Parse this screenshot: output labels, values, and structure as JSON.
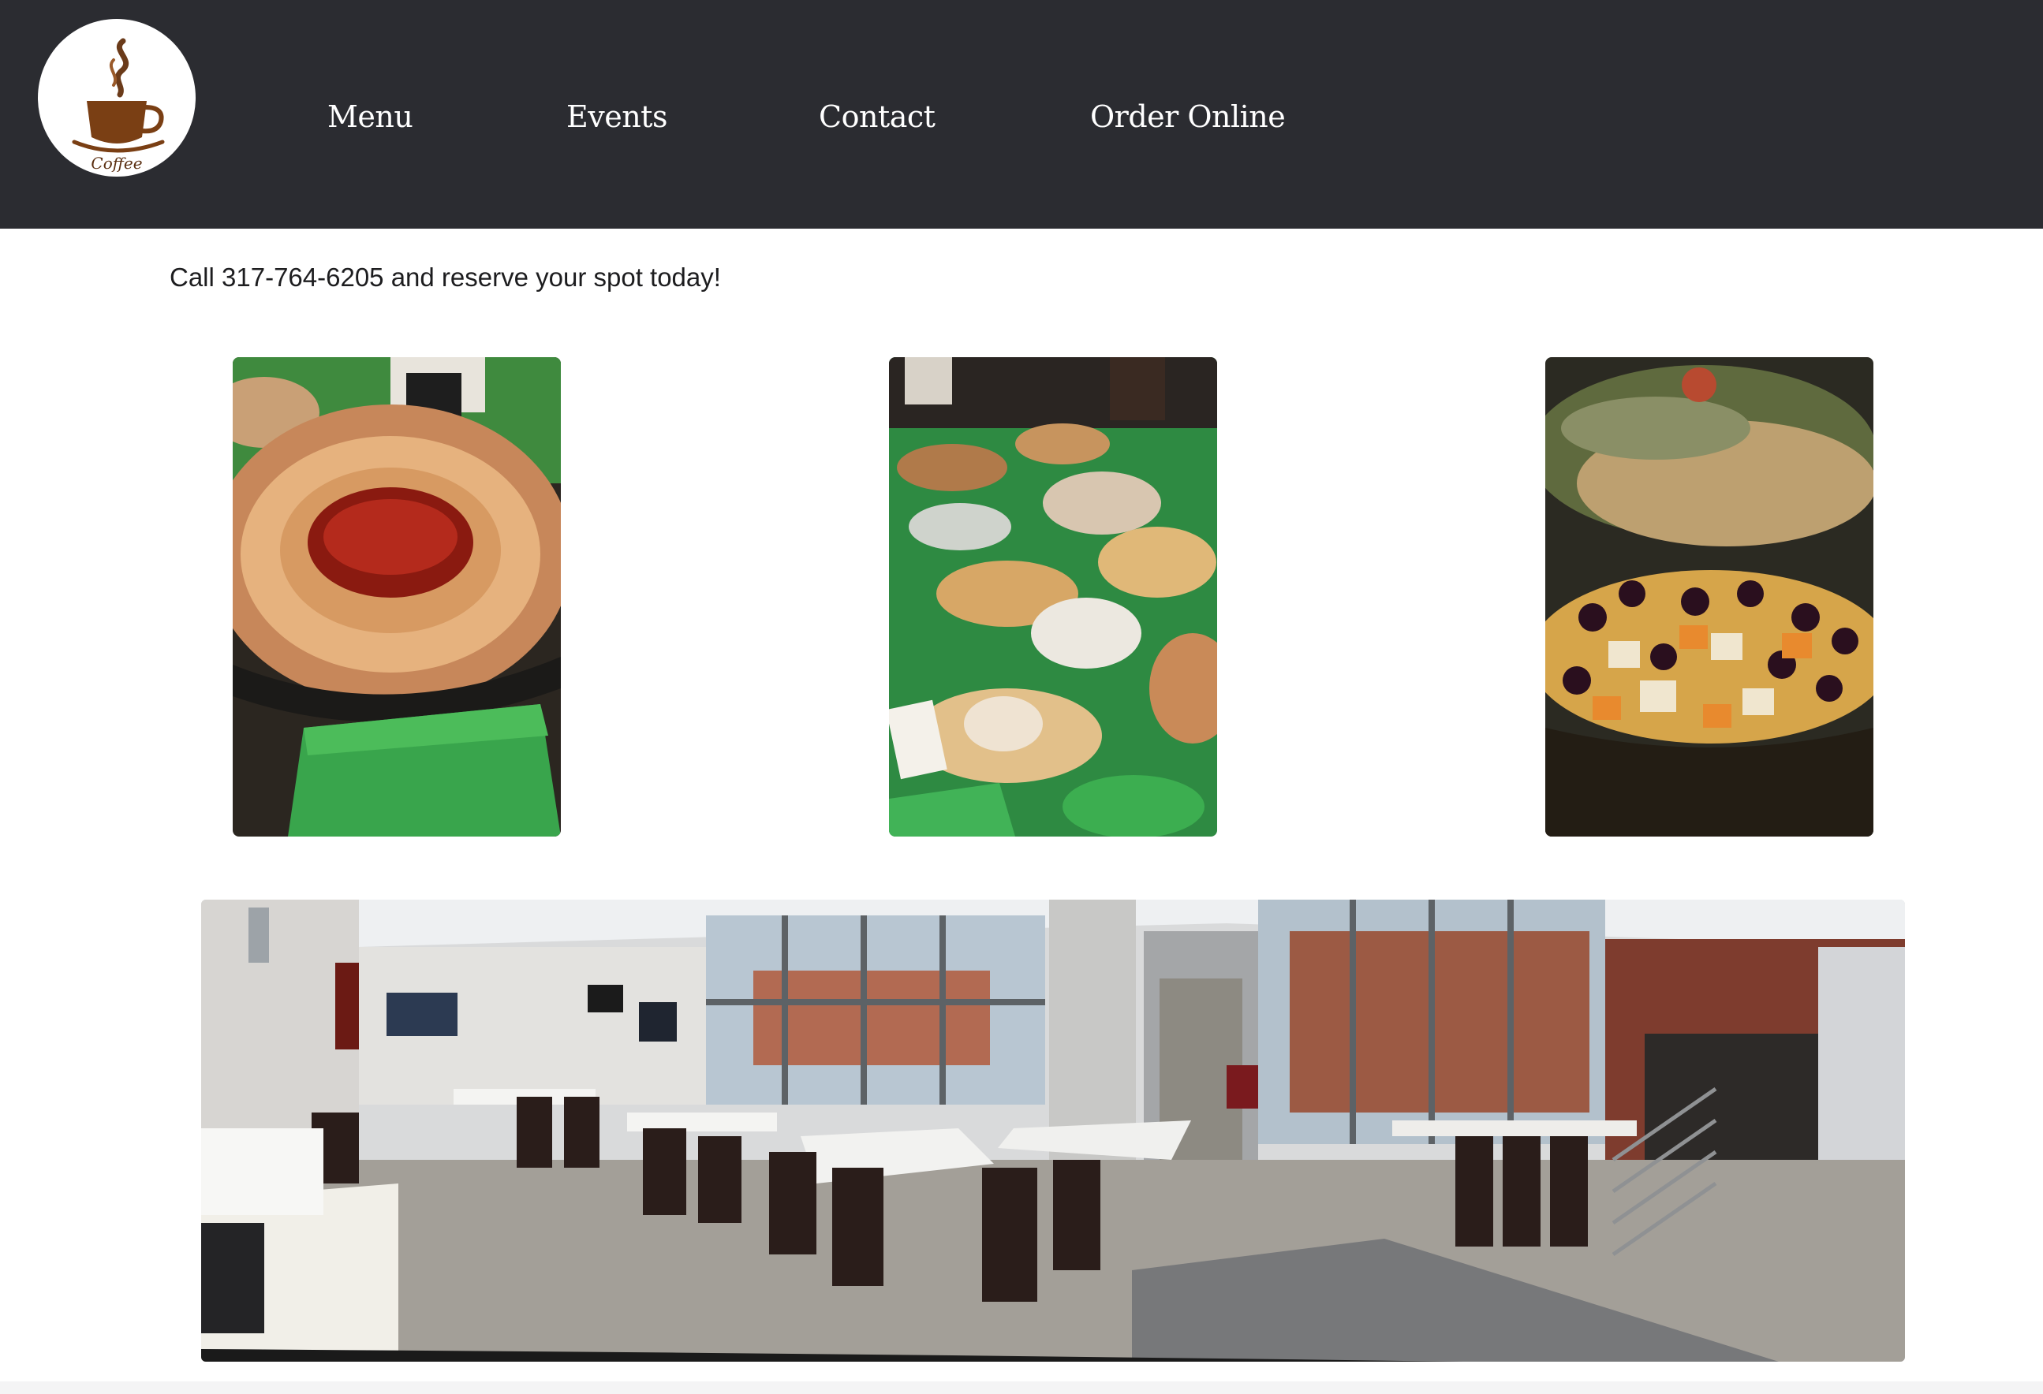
{
  "header": {
    "background": "#2b2c31",
    "logo": {
      "icon": "coffee-cup-icon",
      "text": "Coffee"
    },
    "nav": [
      {
        "label": "Menu"
      },
      {
        "label": "Events"
      },
      {
        "label": "Contact"
      },
      {
        "label": "Order Online"
      }
    ]
  },
  "main": {
    "call_text": "Call 317-764-6205 and reserve your spot today!",
    "photos": [
      {
        "subject": "tortilla-pinwheels-with-salsa-photo"
      },
      {
        "subject": "catering-buffet-table-photo"
      },
      {
        "subject": "cheese-and-grapes-platter-photo"
      },
      {
        "subject": "event-room-panorama-photo"
      }
    ]
  }
}
